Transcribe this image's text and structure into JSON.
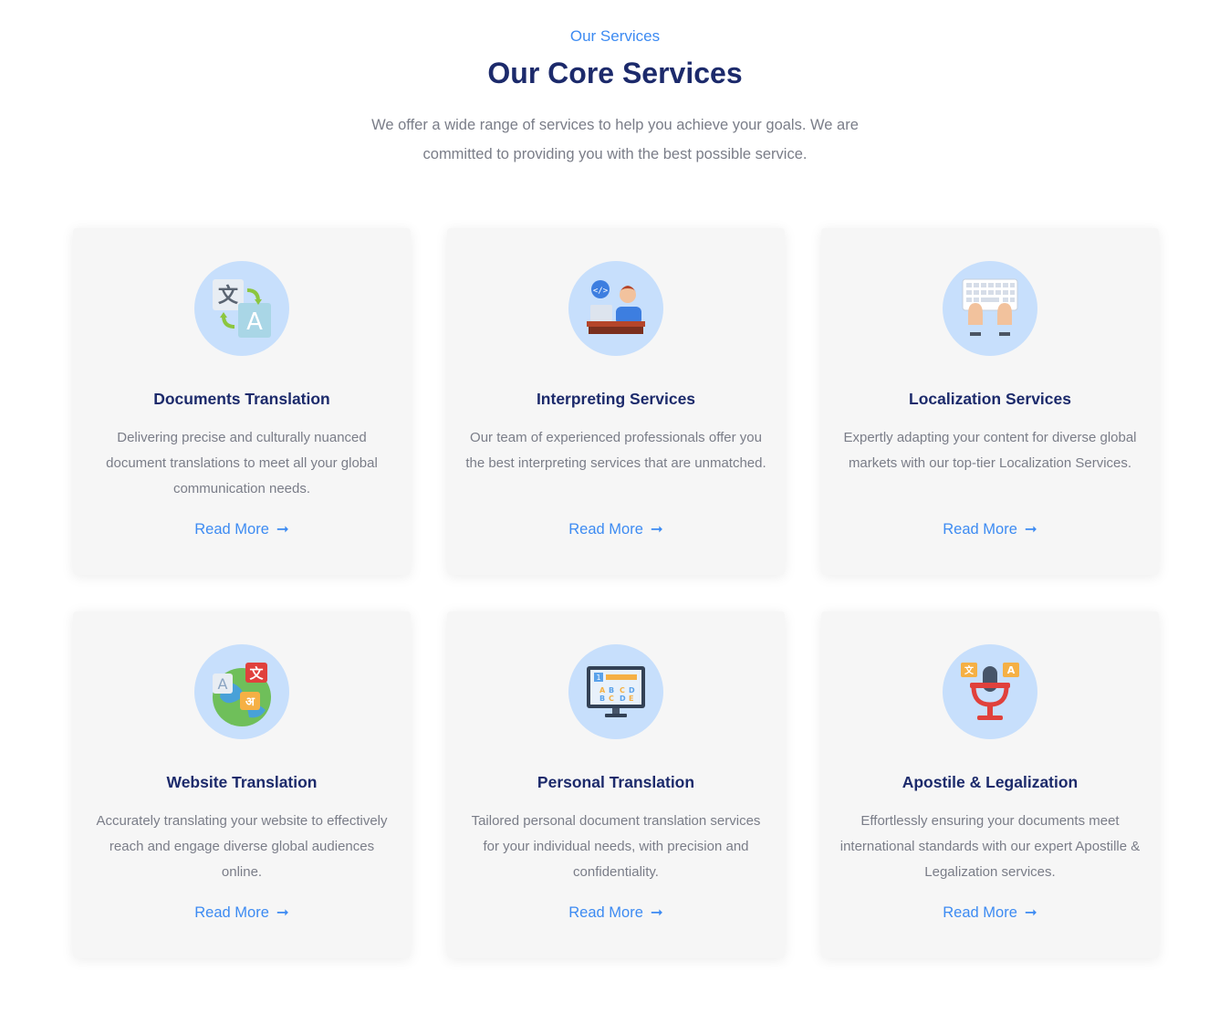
{
  "header": {
    "eyebrow": "Our Services",
    "title": "Our Core Services",
    "intro_line1": "We offer a wide range of services to help you achieve your goals. We are",
    "intro_line2": "committed to providing you with the best possible service."
  },
  "colors": {
    "accent": "#3d8bf2",
    "heading": "#1c2a6b",
    "body_text": "#7a7d88",
    "card_bg": "#f6f6f6",
    "icon_circle": "#c7dffc"
  },
  "cards": [
    {
      "icon": "translate-icon",
      "title": "Documents Translation",
      "desc": "Delivering precise and culturally nuanced document translations to meet all your global communication needs.",
      "link": "Read More"
    },
    {
      "icon": "interpreter-icon",
      "title": "Interpreting Services",
      "desc": "Our team of experienced professionals offer you the best interpreting services that are unmatched.",
      "link": "Read More"
    },
    {
      "icon": "keyboard-icon",
      "title": "Localization Services",
      "desc": "Expertly adapting your content for diverse global markets with our top-tier Localization Services.",
      "link": "Read More"
    },
    {
      "icon": "globe-languages-icon",
      "title": "Website Translation",
      "desc": "Accurately translating your website to effectively reach and engage diverse global audiences online.",
      "link": "Read More"
    },
    {
      "icon": "monitor-icon",
      "title": "Personal Translation",
      "desc": "Tailored personal document translation services for your individual needs, with precision and confidentiality.",
      "link": "Read More"
    },
    {
      "icon": "microphone-icon",
      "title": "Apostile & Legalization",
      "desc": "Effortlessly ensuring your documents meet international standards with our expert Apostille & Legalization services.",
      "link": "Read More"
    }
  ]
}
